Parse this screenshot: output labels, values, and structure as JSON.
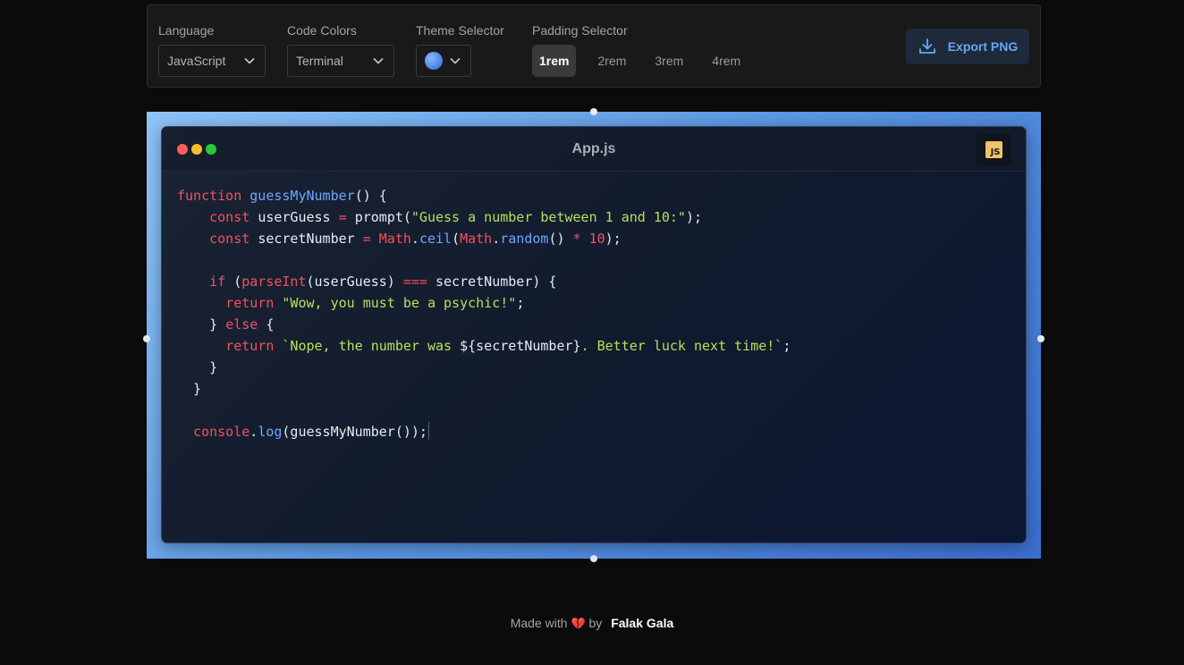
{
  "toolbar": {
    "language": {
      "label": "Language",
      "value": "JavaScript"
    },
    "code_colors": {
      "label": "Code Colors",
      "value": "Terminal"
    },
    "theme": {
      "label": "Theme Selector",
      "color": "#4f8ae8"
    },
    "padding": {
      "label": "Padding Selector",
      "options": [
        "1rem",
        "2rem",
        "3rem",
        "4rem"
      ],
      "selected": "1rem"
    },
    "export_label": "Export PNG"
  },
  "window": {
    "file_name": "App.js",
    "badge": "JS",
    "traffic_colors": [
      "#ff5f57",
      "#febc2e",
      "#28c840"
    ]
  },
  "code": {
    "lines": [
      [
        [
          "kw",
          "function "
        ],
        [
          "fn",
          "guessMyNumber"
        ],
        [
          "p",
          "() {"
        ]
      ],
      [
        [
          "p",
          "    "
        ],
        [
          "kw",
          "const "
        ],
        [
          "p",
          "userGuess "
        ],
        [
          "kw",
          "= "
        ],
        [
          "p",
          "prompt("
        ],
        [
          "str",
          "\"Guess a number between 1 and 10:\""
        ],
        [
          "p",
          ");"
        ]
      ],
      [
        [
          "p",
          "    "
        ],
        [
          "kw",
          "const "
        ],
        [
          "p",
          "secretNumber "
        ],
        [
          "kw",
          "= "
        ],
        [
          "kw",
          "Math"
        ],
        [
          "p",
          "."
        ],
        [
          "fn",
          "ceil"
        ],
        [
          "p",
          "("
        ],
        [
          "kw",
          "Math"
        ],
        [
          "p",
          "."
        ],
        [
          "fn",
          "random"
        ],
        [
          "p",
          "() "
        ],
        [
          "kw",
          "* 10"
        ],
        [
          "p",
          ");"
        ]
      ],
      [
        [
          "p",
          ""
        ]
      ],
      [
        [
          "p",
          "    "
        ],
        [
          "kw",
          "if "
        ],
        [
          "p",
          "("
        ],
        [
          "kw",
          "parseInt"
        ],
        [
          "p",
          "(userGuess) "
        ],
        [
          "kw",
          "=== "
        ],
        [
          "p",
          "secretNumber) {"
        ]
      ],
      [
        [
          "p",
          "      "
        ],
        [
          "kw",
          "return "
        ],
        [
          "str",
          "\"Wow, you must be a psychic!\""
        ],
        [
          "p",
          ";"
        ]
      ],
      [
        [
          "p",
          "    } "
        ],
        [
          "kw",
          "else "
        ],
        [
          "p",
          "{"
        ]
      ],
      [
        [
          "p",
          "      "
        ],
        [
          "kw",
          "return "
        ],
        [
          "str",
          "`Nope, the number was "
        ],
        [
          "p",
          "${secretNumber}"
        ],
        [
          "str",
          ". Better luck next time!`"
        ],
        [
          "p",
          ";"
        ]
      ],
      [
        [
          "p",
          "    }"
        ]
      ],
      [
        [
          "p",
          "  }"
        ]
      ],
      [
        [
          "p",
          ""
        ]
      ],
      [
        [
          "p",
          "  "
        ],
        [
          "kw",
          "console"
        ],
        [
          "p",
          "."
        ],
        [
          "fn",
          "log"
        ],
        [
          "p",
          "(guessMyNumber());"
        ]
      ]
    ]
  },
  "footer": {
    "made_with": "Made with",
    "heart": "💔",
    "by": "by",
    "author": "Falak Gala"
  }
}
